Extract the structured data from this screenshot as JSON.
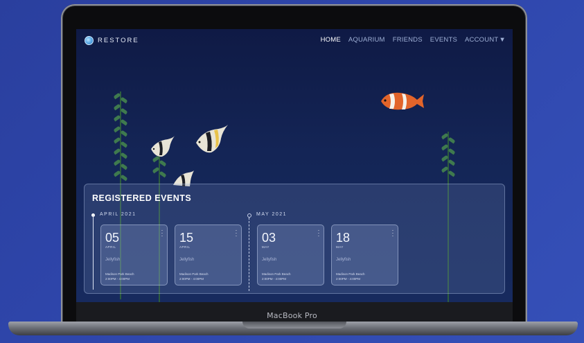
{
  "device": {
    "brand_label": "MacBook Pro"
  },
  "header": {
    "logo_text": "RESTORE",
    "menu": [
      {
        "label": "HOME",
        "active": true
      },
      {
        "label": "AQUARIUM",
        "active": false
      },
      {
        "label": "FRIENDS",
        "active": false
      },
      {
        "label": "EVENTS",
        "active": false
      },
      {
        "label": "ACCOUNT",
        "active": false
      }
    ]
  },
  "events": {
    "title": "REGISTERED EVENTS",
    "groups": [
      {
        "month": "APRIL 2021",
        "cards": [
          {
            "day": "05",
            "month_short": "APRIL",
            "name": "Jellyfish",
            "location": "Madison Park Beach",
            "time": "2:00PM - 4:00PM"
          },
          {
            "day": "15",
            "month_short": "APRIL",
            "name": "Jellyfish",
            "location": "Madison Park Beach",
            "time": "2:00PM - 4:00PM"
          }
        ]
      },
      {
        "month": "MAY 2021",
        "cards": [
          {
            "day": "03",
            "month_short": "MAY",
            "name": "Jellyfish",
            "location": "Madison Park Beach",
            "time": "2:00PM - 4:00PM"
          },
          {
            "day": "18",
            "month_short": "MAY",
            "name": "Jellyfish",
            "location": "Madison Park Beach",
            "time": "2:00PM - 4:00PM"
          }
        ]
      }
    ]
  },
  "colors": {
    "background": "#2f47ad",
    "screen_top": "#0f1a45",
    "plant_leaf": "#3f7a4e",
    "clownfish_orange": "#e2642a"
  }
}
